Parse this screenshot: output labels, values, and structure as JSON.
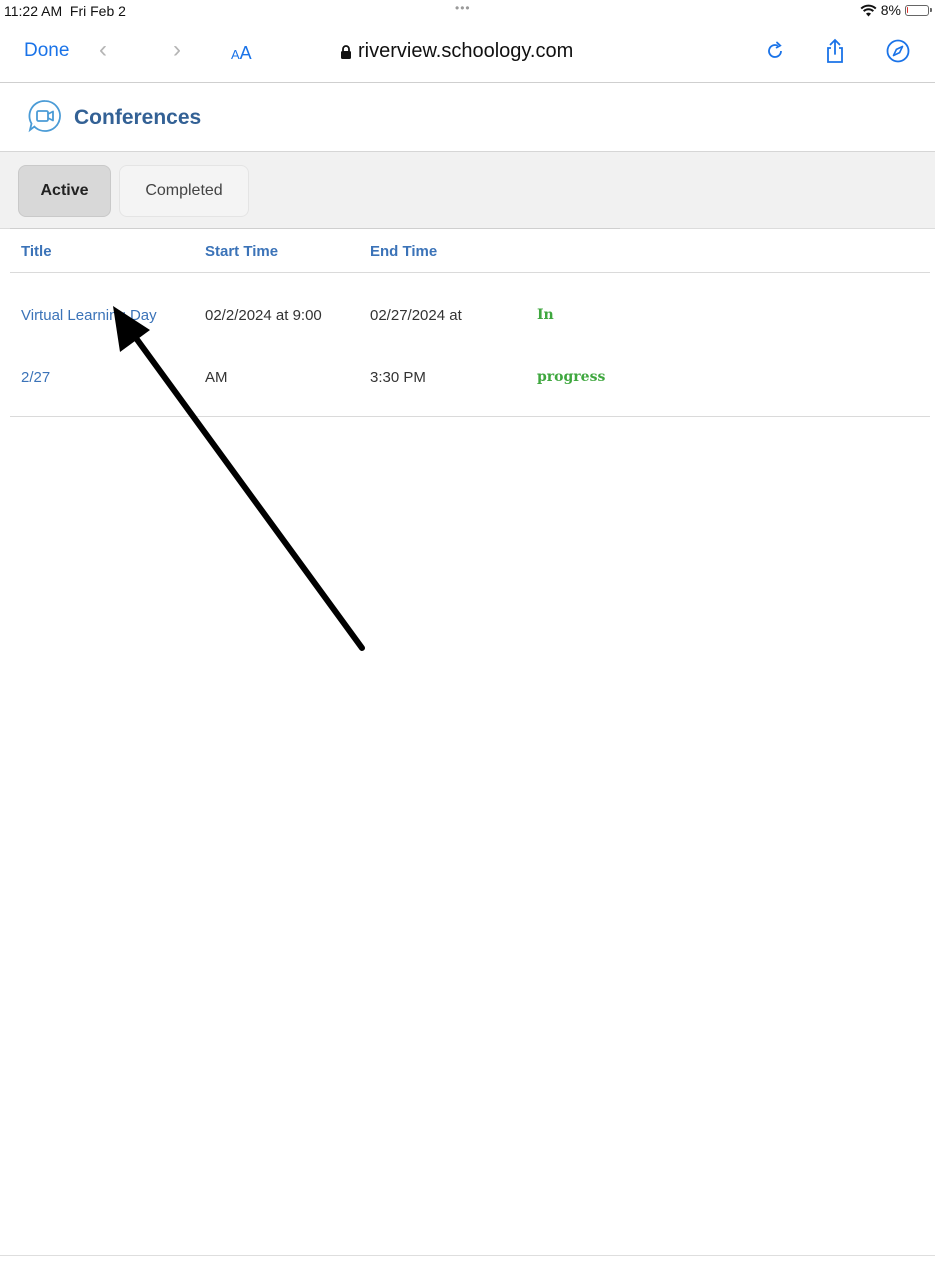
{
  "status_bar": {
    "time": "11:22 AM  Fri Feb 2",
    "dots": "•••",
    "battery_percent": "8%",
    "battery_level": 0.08
  },
  "browser": {
    "done_label": "Done",
    "text_size_label_small": "A",
    "text_size_label_large": "A",
    "url": "riverview.schoology.com"
  },
  "page": {
    "title": "Conferences"
  },
  "tabs": [
    {
      "label": "Active",
      "selected": true
    },
    {
      "label": "Completed",
      "selected": false
    }
  ],
  "table": {
    "headers": {
      "title": "Title",
      "start": "Start Time",
      "end": "End Time"
    },
    "rows": [
      {
        "title_line1": "Virtual Learning Day",
        "title_line2": "2/27",
        "start_line1": "02/2/2024 at 9:00",
        "start_line2": "AM",
        "end_line1": "02/27/2024 at",
        "end_line2": "3:30 PM",
        "status_line1": "In",
        "status_line2": "progress"
      }
    ]
  },
  "colors": {
    "link_blue": "#3b73b8",
    "ios_blue": "#1a73e8",
    "title_blue": "#336195",
    "status_green": "#3fa73f"
  }
}
